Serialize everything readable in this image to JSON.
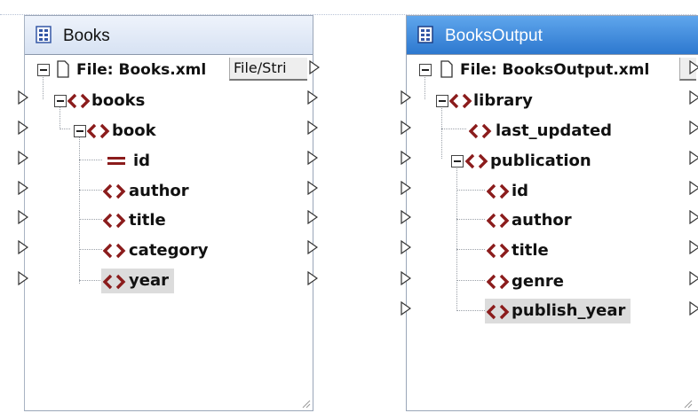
{
  "source": {
    "title": "Books",
    "file_label": "File: Books.xml",
    "file_button": "File/Stri",
    "nodes": [
      "books",
      "book",
      "id",
      "author",
      "title",
      "category",
      "year"
    ]
  },
  "target": {
    "title": "BooksOutput",
    "file_label": "File: BooksOutput.xml",
    "nodes": [
      "library",
      "last_updated",
      "publication",
      "id",
      "author",
      "title",
      "genre",
      "publish_year"
    ]
  },
  "colors": {
    "tag": "#8b1c1c",
    "header_active": "#2d78cf",
    "header_inactive": "#d7e2f3"
  },
  "icons": [
    "component-icon",
    "collapse-icon",
    "file-icon",
    "element-icon",
    "attribute-icon",
    "connector-icon"
  ]
}
